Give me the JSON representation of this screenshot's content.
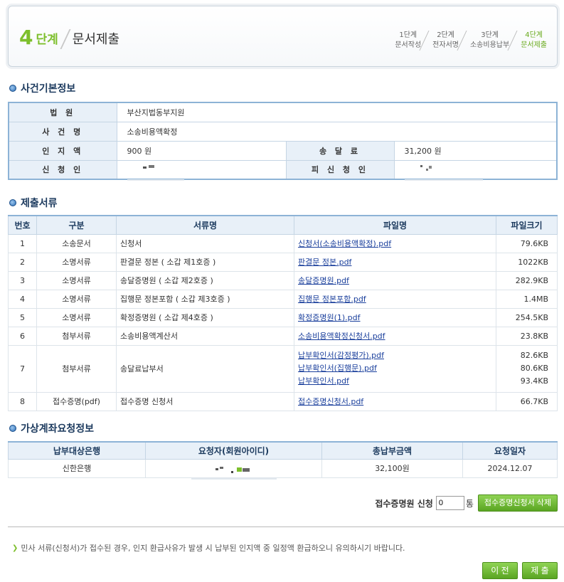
{
  "header": {
    "step_num": "4",
    "step_label": "단계",
    "step_name": "문서제출",
    "steps": [
      {
        "num": "1단계",
        "name": "문서작성"
      },
      {
        "num": "2단계",
        "name": "전자서명"
      },
      {
        "num": "3단계",
        "name": "소송비용납부"
      },
      {
        "num": "4단계",
        "name": "문서제출"
      }
    ]
  },
  "case_info": {
    "title": "사건기본정보",
    "court_label": "법 원",
    "court_value": "부산지법동부지원",
    "case_name_label": "사 건 명",
    "case_name_value": "소송비용액확정",
    "stamp_label": "인 지 액",
    "stamp_value": "900 원",
    "delivery_label": "송 달 료",
    "delivery_value": "31,200 원",
    "applicant_label": "신 청 인",
    "respondent_label": "피 신 청 인"
  },
  "documents": {
    "title": "제출서류",
    "headers": [
      "번호",
      "구분",
      "서류명",
      "파일명",
      "파일크기"
    ],
    "rows": [
      {
        "no": "1",
        "type": "소송문서",
        "name": "신청서",
        "files": [
          "신청서(소송비용액확정).pdf"
        ],
        "sizes": [
          "79.6KB"
        ]
      },
      {
        "no": "2",
        "type": "소명서류",
        "name": "판결문 정본 ( 소갑 제1호증 )",
        "files": [
          "판결문 정본.pdf"
        ],
        "sizes": [
          "1022KB"
        ]
      },
      {
        "no": "3",
        "type": "소명서류",
        "name": "송달증명원 ( 소갑 제2호증 )",
        "files": [
          "송달증명원.pdf"
        ],
        "sizes": [
          "282.9KB"
        ]
      },
      {
        "no": "4",
        "type": "소명서류",
        "name": "집행문 정본포함 ( 소갑 제3호증 )",
        "files": [
          "집행문 정본포함.pdf"
        ],
        "sizes": [
          "1.4MB"
        ]
      },
      {
        "no": "5",
        "type": "소명서류",
        "name": "확정증명원 ( 소갑 제4호증 )",
        "files": [
          "확정증명원(1).pdf"
        ],
        "sizes": [
          "254.5KB"
        ]
      },
      {
        "no": "6",
        "type": "첨부서류",
        "name": "소송비용액계산서",
        "files": [
          "소송비용액확정신청서.pdf"
        ],
        "sizes": [
          "23.8KB"
        ]
      },
      {
        "no": "7",
        "type": "첨부서류",
        "name": "송달료납부서",
        "files": [
          "납부확인서(감정평가).pdf",
          "납부확인서(집행문).pdf",
          "납부확인서.pdf"
        ],
        "sizes": [
          "82.6KB",
          "80.6KB",
          "93.4KB"
        ]
      },
      {
        "no": "8",
        "type": "접수증명(pdf)",
        "name": "접수증명 신청서",
        "files": [
          "접수증명신청서.pdf"
        ],
        "sizes": [
          "66.7KB"
        ]
      }
    ]
  },
  "virtual_account": {
    "title": "가상계좌요청정보",
    "headers": [
      "납부대상은행",
      "요청자(회원아이디)",
      "총납부금액",
      "요청일자"
    ],
    "bank": "신한은행",
    "amount": "32,100원",
    "date": "2024.12.07"
  },
  "receipt": {
    "label": "접수증명원 신청",
    "count": "0",
    "unit": "통",
    "delete_button": "접수증명신청서 삭제"
  },
  "notice": "민사 서류(신청서)가 접수된 경우, 인지 환급사유가 발생 시 납부된 인지액 중 일정액 환급하오니 유의하시기 바랍니다.",
  "buttons": {
    "prev": "이 전",
    "submit": "제 출"
  },
  "colors": {
    "accent_green": "#7dbf2c",
    "header_bg": "#e8f0f8",
    "link": "#1a3f9c"
  }
}
